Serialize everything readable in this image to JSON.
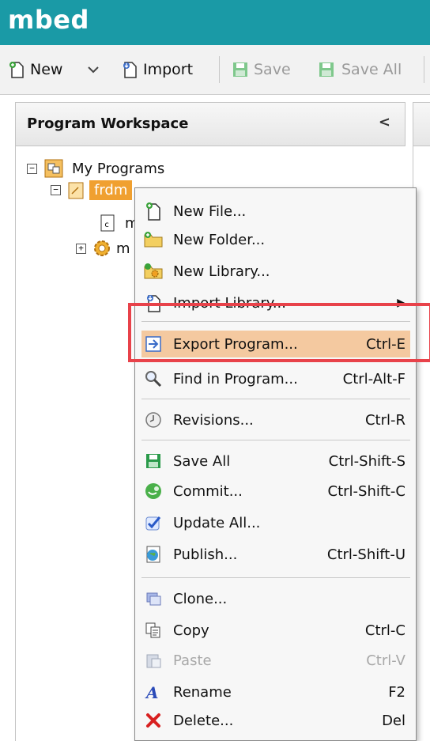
{
  "app": {
    "title": "mbed"
  },
  "toolbar": {
    "new_label": "New",
    "import_label": "Import",
    "save_label": "Save",
    "save_all_label": "Save All"
  },
  "workspace": {
    "title": "Program Workspace",
    "collapse_icon": "chevron-left-icon",
    "tree": {
      "root_label": "My Programs",
      "program_label": "frdm",
      "child1_label": "m",
      "child2_label": "m"
    }
  },
  "context_menu": {
    "items": [
      {
        "label": "New File...",
        "shortcut": "",
        "icon": "new-file-icon"
      },
      {
        "label": "New Folder...",
        "shortcut": "",
        "icon": "new-folder-icon"
      },
      {
        "label": "New Library...",
        "shortcut": "",
        "icon": "new-library-icon"
      },
      {
        "label": "Import Library...",
        "shortcut": "",
        "icon": "import-library-icon",
        "submenu": true
      },
      {
        "label": "Export Program...",
        "shortcut": "Ctrl-E",
        "icon": "export-icon",
        "highlighted": true
      },
      {
        "label": "Find in Program...",
        "shortcut": "Ctrl-Alt-F",
        "icon": "search-icon"
      },
      {
        "label": "Revisions...",
        "shortcut": "Ctrl-R",
        "icon": "clock-icon"
      },
      {
        "label": "Save All",
        "shortcut": "Ctrl-Shift-S",
        "icon": "save-icon"
      },
      {
        "label": "Commit...",
        "shortcut": "Ctrl-Shift-C",
        "icon": "commit-icon"
      },
      {
        "label": "Update All...",
        "shortcut": "",
        "icon": "checkmark-icon"
      },
      {
        "label": "Publish...",
        "shortcut": "Ctrl-Shift-U",
        "icon": "globe-icon"
      },
      {
        "label": "Clone...",
        "shortcut": "",
        "icon": "clone-icon"
      },
      {
        "label": "Copy",
        "shortcut": "Ctrl-C",
        "icon": "copy-icon"
      },
      {
        "label": "Paste",
        "shortcut": "Ctrl-V",
        "icon": "paste-icon",
        "disabled": true
      },
      {
        "label": "Rename",
        "shortcut": "F2",
        "icon": "rename-icon"
      },
      {
        "label": "Delete...",
        "shortcut": "Del",
        "icon": "delete-icon"
      }
    ]
  },
  "colors": {
    "header_bg": "#1a9aa6",
    "selection": "#f0a030",
    "menu_highlight": "#f4c9a0",
    "annotation": "#e8424a"
  }
}
